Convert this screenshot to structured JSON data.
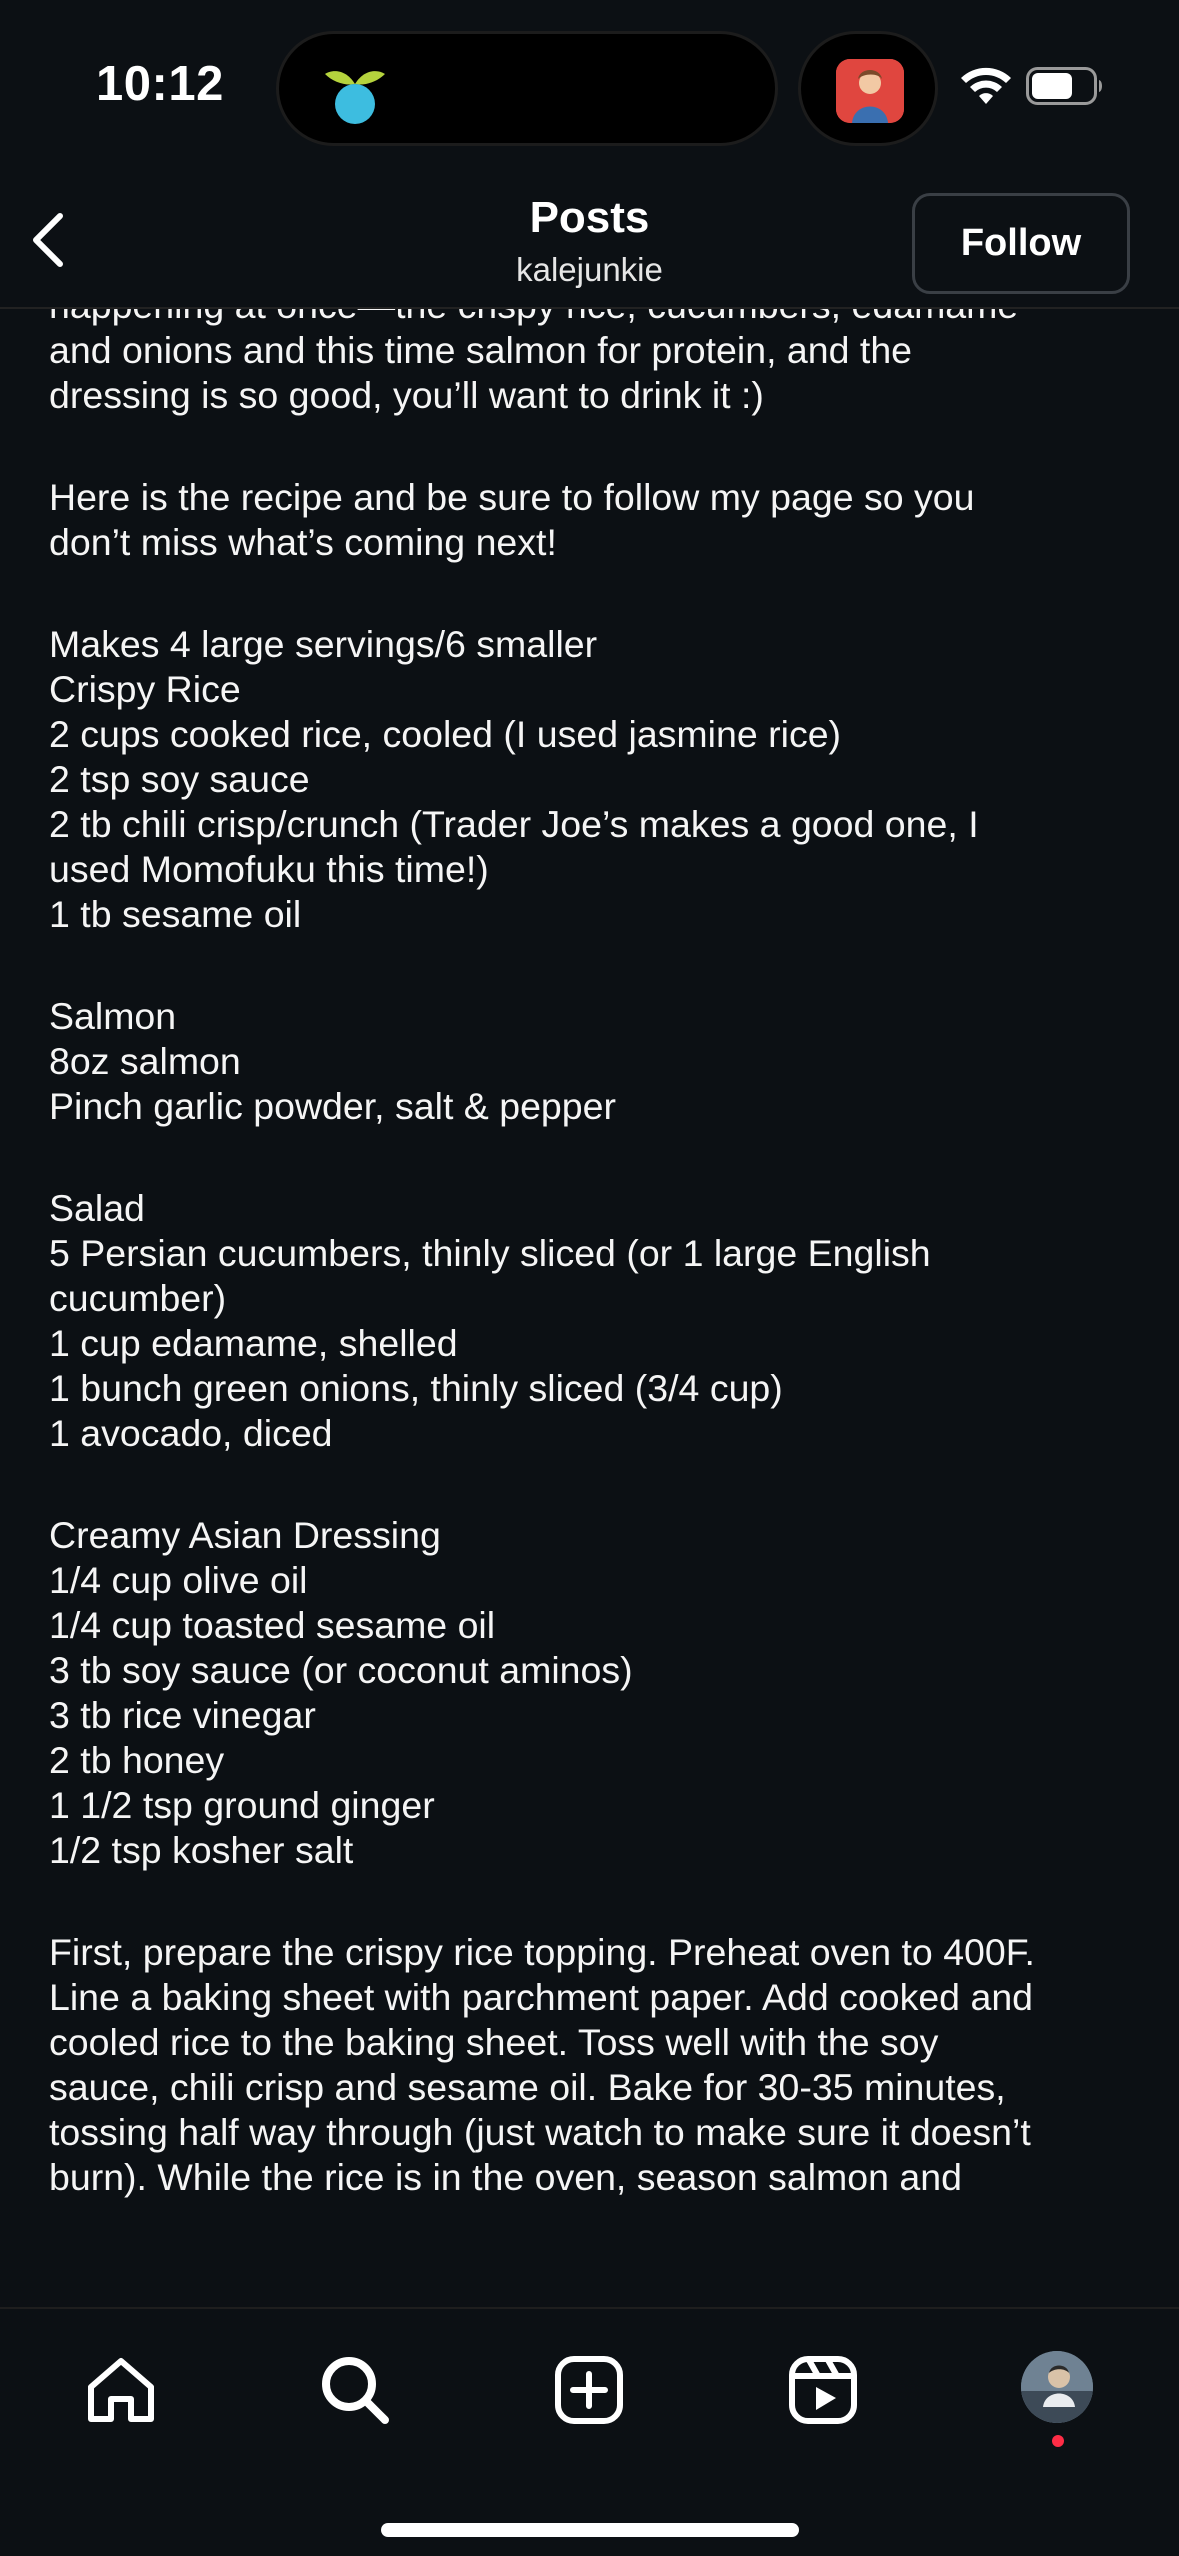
{
  "status_bar": {
    "time": "10:12",
    "island_app_icon": "leaf-app-icon",
    "live_activity_icon": "media-thumbnail",
    "wifi_icon": "wifi-icon",
    "battery_icon": "battery-icon"
  },
  "header": {
    "back_icon": "chevron-left-icon",
    "title": "Posts",
    "username": "kalejunkie",
    "follow_label": "Follow"
  },
  "caption": {
    "lines": [
      "happening at once—the crispy rice, cucumbers, edamame",
      "and onions and this time salmon for protein, and the",
      "dressing is so good, you’ll want to drink it :)",
      "",
      "Here is the recipe and be sure to follow my page so you",
      "don’t miss what’s coming next!",
      "",
      "Makes 4 large servings/6 smaller",
      "Crispy Rice",
      "2 cups cooked rice, cooled (I used jasmine rice)",
      "2 tsp soy sauce",
      "2 tb chili crisp/crunch (Trader Joe’s makes a good one, I",
      "used Momofuku this time!)",
      "1 tb sesame oil",
      "",
      "Salmon",
      "8oz salmon",
      "Pinch garlic powder, salt & pepper",
      "",
      "Salad",
      "5 Persian cucumbers, thinly sliced (or 1 large English",
      "cucumber)",
      "1 cup edamame, shelled",
      "1 bunch green onions, thinly sliced (3/4 cup)",
      "1 avocado, diced",
      "",
      "Creamy Asian Dressing",
      "1/4 cup olive oil",
      "1/4 cup toasted sesame oil",
      "3 tb soy sauce (or coconut aminos)",
      "3 tb rice vinegar",
      "2 tb honey",
      "1 1/2 tsp ground ginger",
      "1/2 tsp kosher salt",
      "",
      "First, prepare the crispy rice topping. Preheat oven to 400F.",
      "Line a baking sheet with parchment paper. Add cooked and",
      "cooled rice to the baking sheet. Toss well with the soy",
      "sauce, chili crisp and sesame oil. Bake for 30-35 minutes,",
      "tossing half way through (just watch to make sure it doesn’t",
      "burn). While the rice is in the oven, season salmon and"
    ]
  },
  "bottom_nav": {
    "items": [
      {
        "name": "home-icon"
      },
      {
        "name": "search-icon"
      },
      {
        "name": "create-post-icon"
      },
      {
        "name": "reels-icon"
      },
      {
        "name": "profile-avatar"
      }
    ],
    "notification_dot_color": "#ff2d46"
  }
}
